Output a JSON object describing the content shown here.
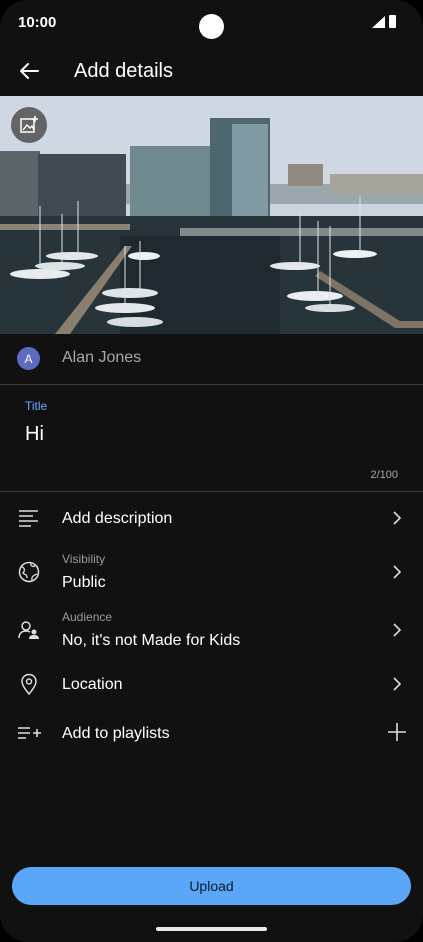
{
  "status": {
    "time": "10:00"
  },
  "header": {
    "title": "Add details"
  },
  "author": {
    "initial": "A",
    "name": "Alan Jones"
  },
  "title_field": {
    "label": "Title",
    "value": "Hi",
    "counter": "2/100"
  },
  "rows": {
    "description": {
      "label": "Add description"
    },
    "visibility": {
      "sublabel": "Visibility",
      "value": "Public"
    },
    "audience": {
      "sublabel": "Audience",
      "value": "No, it's not Made for Kids"
    },
    "location": {
      "label": "Location"
    },
    "playlists": {
      "label": "Add to playlists"
    }
  },
  "upload": {
    "label": "Upload"
  },
  "colors": {
    "accent": "#5aa7f7",
    "label_blue": "#6ea8ff",
    "background": "#111111"
  },
  "icons": [
    "back-arrow-icon",
    "add-photo-icon",
    "description-lines-icon",
    "globe-icon",
    "people-icon",
    "location-pin-icon",
    "playlist-add-icon",
    "chevron-right-icon",
    "plus-icon"
  ]
}
